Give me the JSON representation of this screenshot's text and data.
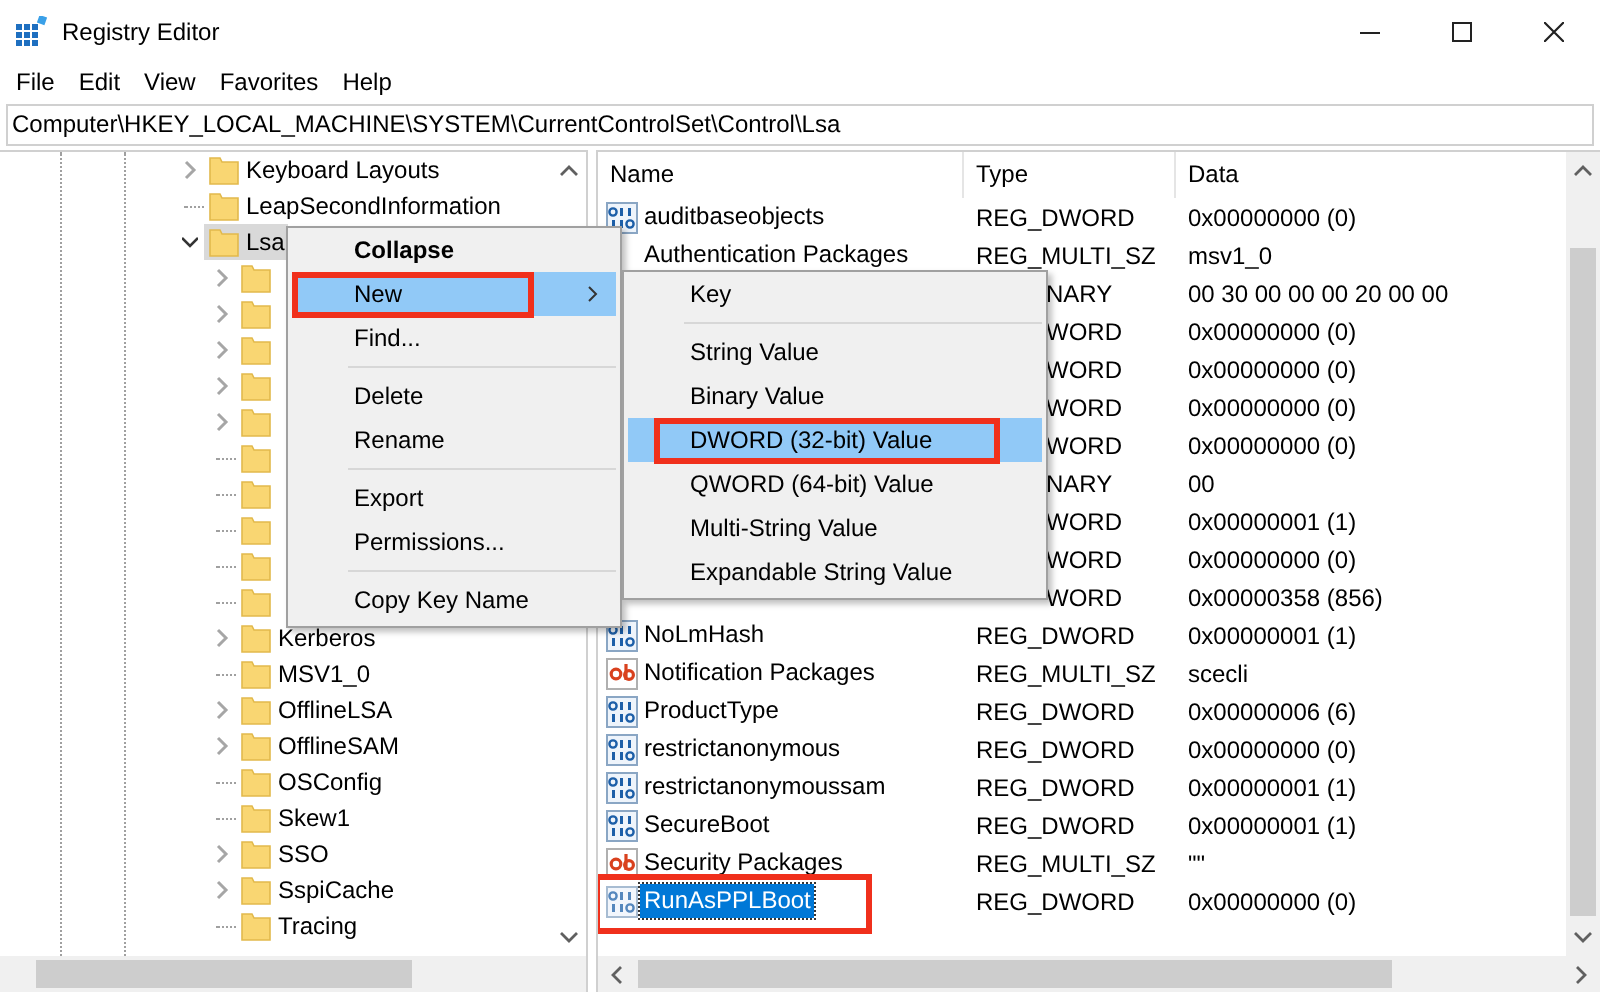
{
  "window": {
    "title": "Registry Editor"
  },
  "menu_bar": [
    "File",
    "Edit",
    "View",
    "Favorites",
    "Help"
  ],
  "address_bar": {
    "value": "Computer\\HKEY_LOCAL_MACHINE\\SYSTEM\\CurrentControlSet\\Control\\Lsa"
  },
  "tree": {
    "items": [
      {
        "label": "Keyboard Layouts",
        "expandable": true,
        "expanded": false,
        "selected": false
      },
      {
        "label": "LeapSecondInformation",
        "expandable": false,
        "selected": false
      },
      {
        "label": "Lsa",
        "expandable": true,
        "expanded": true,
        "selected": true,
        "children": [
          {
            "expandable": true,
            "expanded": false,
            "selected": false
          },
          {
            "expandable": true,
            "expanded": false,
            "selected": false
          },
          {
            "expandable": true,
            "expanded": false,
            "selected": false
          },
          {
            "expandable": true,
            "expanded": false,
            "selected": false
          },
          {
            "expandable": true,
            "expanded": false,
            "selected": false
          },
          {
            "expandable": false,
            "selected": false
          },
          {
            "expandable": false,
            "selected": false
          },
          {
            "expandable": false,
            "selected": false
          },
          {
            "expandable": false,
            "selected": false
          },
          {
            "expandable": false,
            "selected": false
          },
          {
            "label": "Kerberos",
            "expandable": true,
            "expanded": false,
            "selected": false
          },
          {
            "label": "MSV1_0",
            "expandable": false,
            "selected": false
          },
          {
            "label": "OfflineLSA",
            "expandable": true,
            "expanded": false,
            "selected": false
          },
          {
            "label": "OfflineSAM",
            "expandable": true,
            "expanded": false,
            "selected": false
          },
          {
            "label": "OSConfig",
            "expandable": false,
            "selected": false
          },
          {
            "label": "Skew1",
            "expandable": false,
            "selected": false
          },
          {
            "label": "SSO",
            "expandable": true,
            "expanded": false,
            "selected": false
          },
          {
            "label": "SspiCache",
            "expandable": true,
            "expanded": false,
            "selected": false
          },
          {
            "label": "Tracing",
            "expandable": false,
            "selected": false
          }
        ]
      }
    ]
  },
  "values": {
    "columns": [
      "Name",
      "Type",
      "Data"
    ],
    "rows": [
      {
        "kind": "dword",
        "name": "auditbaseobjects",
        "type": "REG_DWORD",
        "data": "0x00000000 (0)",
        "selected": false
      },
      {
        "name": "Authentication Packages",
        "type": "REG_MULTI_SZ",
        "data": "msv1_0",
        "selected": false
      },
      {
        "type": "NARY",
        "data": "00 30 00 00 00 20 00 00"
      },
      {
        "type": "WORD",
        "data": "0x00000000 (0)"
      },
      {
        "type": "WORD",
        "data": "0x00000000 (0)"
      },
      {
        "type": "WORD",
        "data": "0x00000000 (0)"
      },
      {
        "type": "WORD",
        "data": "0x00000000 (0)"
      },
      {
        "type": "NARY",
        "data": "00"
      },
      {
        "type": "WORD",
        "data": "0x00000001 (1)"
      },
      {
        "type": "WORD",
        "data": "0x00000000 (0)"
      },
      {
        "type": "WORD",
        "data": "0x00000358 (856)"
      },
      {
        "kind": "dword",
        "name": "NoLmHash",
        "type": "REG_DWORD",
        "data": "0x00000001 (1)",
        "selected": false
      },
      {
        "kind": "sz",
        "name": "Notification Packages",
        "type": "REG_MULTI_SZ",
        "data": "scecli",
        "selected": false
      },
      {
        "kind": "dword",
        "name": "ProductType",
        "type": "REG_DWORD",
        "data": "0x00000006 (6)",
        "selected": false
      },
      {
        "kind": "dword",
        "name": "restrictanonymous",
        "type": "REG_DWORD",
        "data": "0x00000000 (0)",
        "selected": false
      },
      {
        "kind": "dword",
        "name": "restrictanonymoussam",
        "type": "REG_DWORD",
        "data": "0x00000001 (1)",
        "selected": false
      },
      {
        "kind": "dword",
        "name": "SecureBoot",
        "type": "REG_DWORD",
        "data": "0x00000001 (1)",
        "selected": false
      },
      {
        "kind": "sz",
        "name": "Security Packages",
        "type": "REG_MULTI_SZ",
        "data": "\"\"",
        "selected": false
      },
      {
        "kind": "dword",
        "name": "RunAsPPLBoot",
        "type": "REG_DWORD",
        "data": "0x00000000 (0)",
        "selected": true,
        "callout": true
      }
    ]
  },
  "context_menu": {
    "items": [
      {
        "kind": "item",
        "label": "Collapse",
        "bold": true,
        "selected": false
      },
      {
        "kind": "submenu",
        "label": "New",
        "selected": true,
        "callout": true
      },
      {
        "kind": "item",
        "label": "Find...",
        "selected": false
      },
      {
        "kind": "separator"
      },
      {
        "kind": "item",
        "label": "Delete",
        "selected": false
      },
      {
        "kind": "item",
        "label": "Rename",
        "selected": false
      },
      {
        "kind": "separator"
      },
      {
        "kind": "item",
        "label": "Export",
        "selected": false
      },
      {
        "kind": "item",
        "label": "Permissions...",
        "selected": false
      },
      {
        "kind": "separator"
      },
      {
        "kind": "item",
        "label": "Copy Key Name",
        "selected": false
      }
    ]
  },
  "submenu": {
    "items": [
      {
        "kind": "item",
        "label": "Key",
        "selected": false
      },
      {
        "kind": "separator"
      },
      {
        "kind": "item",
        "label": "String Value",
        "selected": false
      },
      {
        "kind": "item",
        "label": "Binary Value",
        "selected": false
      },
      {
        "kind": "item",
        "label": "DWORD (32-bit) Value",
        "selected": true,
        "callout": true
      },
      {
        "kind": "item",
        "label": "QWORD (64-bit) Value",
        "selected": false
      },
      {
        "kind": "item",
        "label": "Multi-String Value",
        "selected": false
      },
      {
        "kind": "item",
        "label": "Expandable String Value",
        "selected": false
      }
    ]
  }
}
